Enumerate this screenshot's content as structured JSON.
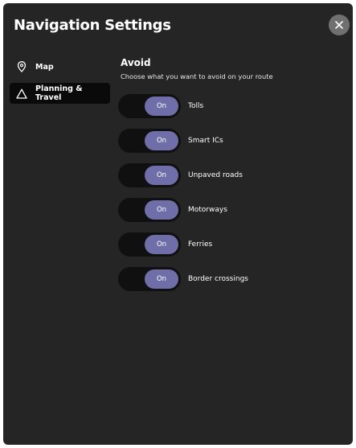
{
  "header": {
    "title": "Navigation Settings",
    "close_icon": "close-icon"
  },
  "sidebar": {
    "items": [
      {
        "label": "Map",
        "icon": "location-pin-icon",
        "active": false
      },
      {
        "label": "Planning & Travel",
        "icon": "triangle-icon",
        "active": true
      }
    ]
  },
  "avoid": {
    "title": "Avoid",
    "subtitle": "Choose what you want to avoid on your route",
    "options": [
      {
        "label": "Tolls",
        "state": "On"
      },
      {
        "label": "Smart ICs",
        "state": "On"
      },
      {
        "label": "Unpaved roads",
        "state": "On"
      },
      {
        "label": "Motorways",
        "state": "On"
      },
      {
        "label": "Ferries",
        "state": "On"
      },
      {
        "label": "Border crossings",
        "state": "On"
      }
    ]
  },
  "colors": {
    "panel_bg": "#252525",
    "toggle_track": "#101010",
    "toggle_knob": "#6f6ea9",
    "active_sidebar": "#0a0a0a",
    "close_button": "#707070"
  }
}
